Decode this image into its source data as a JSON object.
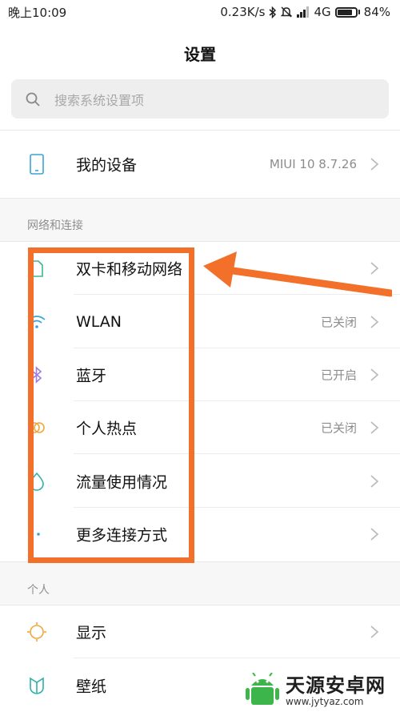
{
  "status_bar": {
    "time": "晚上10:09",
    "speed": "0.23K/s",
    "network": "4G",
    "battery": "84%",
    "battery_level": 0.84
  },
  "header": {
    "title": "设置"
  },
  "search": {
    "placeholder": "搜索系统设置项"
  },
  "device_row": {
    "label": "我的设备",
    "value": "MIUI 10 8.7.26"
  },
  "network_section": {
    "title": "网络和连接",
    "items": [
      {
        "label": "双卡和移动网络",
        "value": "",
        "icon": "sim-card-icon"
      },
      {
        "label": "WLAN",
        "value": "已关闭",
        "icon": "wifi-icon"
      },
      {
        "label": "蓝牙",
        "value": "已开启",
        "icon": "bluetooth-icon"
      },
      {
        "label": "个人热点",
        "value": "已关闭",
        "icon": "hotspot-icon"
      },
      {
        "label": "流量使用情况",
        "value": "",
        "icon": "data-usage-icon"
      },
      {
        "label": "更多连接方式",
        "value": "",
        "icon": "more-dots-icon"
      }
    ]
  },
  "personal_section": {
    "title": "个人",
    "items": [
      {
        "label": "显示",
        "icon": "display-icon"
      },
      {
        "label": "壁纸",
        "icon": "wallpaper-icon"
      }
    ]
  },
  "annotation": {
    "color": "#f2702a"
  },
  "watermark": {
    "name": "天源安卓网",
    "url": "www.jytyaz.com"
  }
}
